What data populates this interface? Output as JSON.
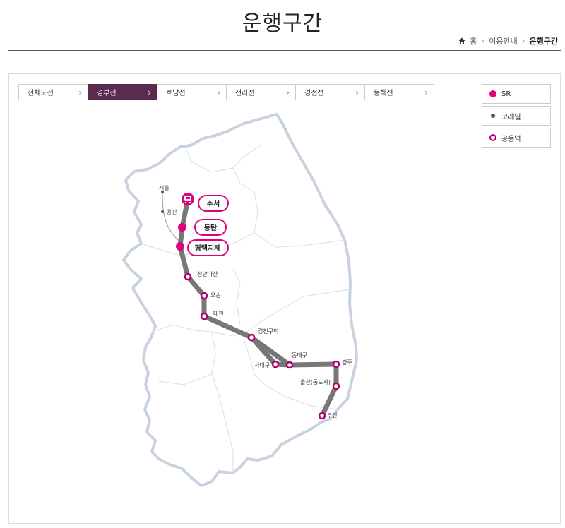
{
  "page": {
    "title": "운행구간"
  },
  "breadcrumb": {
    "home": "홈",
    "section": "이용안내",
    "current": "운행구간"
  },
  "tabs": [
    {
      "label": "전체노선",
      "active": false
    },
    {
      "label": "경부선",
      "active": true
    },
    {
      "label": "호남선",
      "active": false
    },
    {
      "label": "전라선",
      "active": false
    },
    {
      "label": "경전선",
      "active": false
    },
    {
      "label": "동해선",
      "active": false
    }
  ],
  "legend": [
    {
      "label": "SR",
      "symbol": "filled-pink-dot"
    },
    {
      "label": "코레일",
      "symbol": "small-gray-dot"
    },
    {
      "label": "공용역",
      "symbol": "pink-ring"
    }
  ],
  "map": {
    "korail_stations": [
      "서울",
      "용산"
    ],
    "sr_stations": [
      "수서",
      "동탄",
      "평택지제"
    ],
    "shared_stations": [
      "천안아산",
      "오송",
      "대전",
      "김천구미",
      "서대구",
      "동대구",
      "경주",
      "울산(통도사)",
      "부산"
    ]
  },
  "colors": {
    "sr": "#e2007a",
    "shared_ring": "#b0006a",
    "route": "#777777",
    "active_tab": "#5a2b4e"
  }
}
